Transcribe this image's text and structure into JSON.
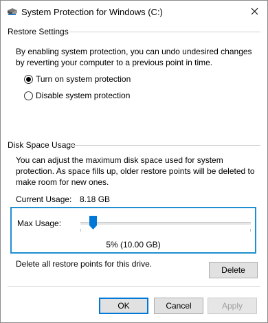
{
  "window": {
    "title": "System Protection for Windows (C:)",
    "close_icon": "close-icon"
  },
  "restore_settings": {
    "header": "Restore Settings",
    "description": "By enabling system protection, you can undo undesired changes by reverting your computer to a previous point in time.",
    "options": [
      {
        "label": "Turn on system protection",
        "selected": true
      },
      {
        "label": "Disable system protection",
        "selected": false
      }
    ]
  },
  "disk_space": {
    "header": "Disk Space Usage",
    "description": "You can adjust the maximum disk space used for system protection. As space fills up, older restore points will be deleted to make room for new ones.",
    "current_usage_label": "Current Usage:",
    "current_usage_value": "8.18 GB",
    "max_usage_label": "Max Usage:",
    "max_usage_fraction": 0.05,
    "max_usage_readout": "5% (10.00 GB)",
    "delete_description": "Delete all restore points for this drive.",
    "delete_button": "Delete"
  },
  "footer": {
    "ok": "OK",
    "cancel": "Cancel",
    "apply": "Apply"
  },
  "colors": {
    "accent": "#0078d7",
    "focus_border": "#1e8fd0"
  }
}
